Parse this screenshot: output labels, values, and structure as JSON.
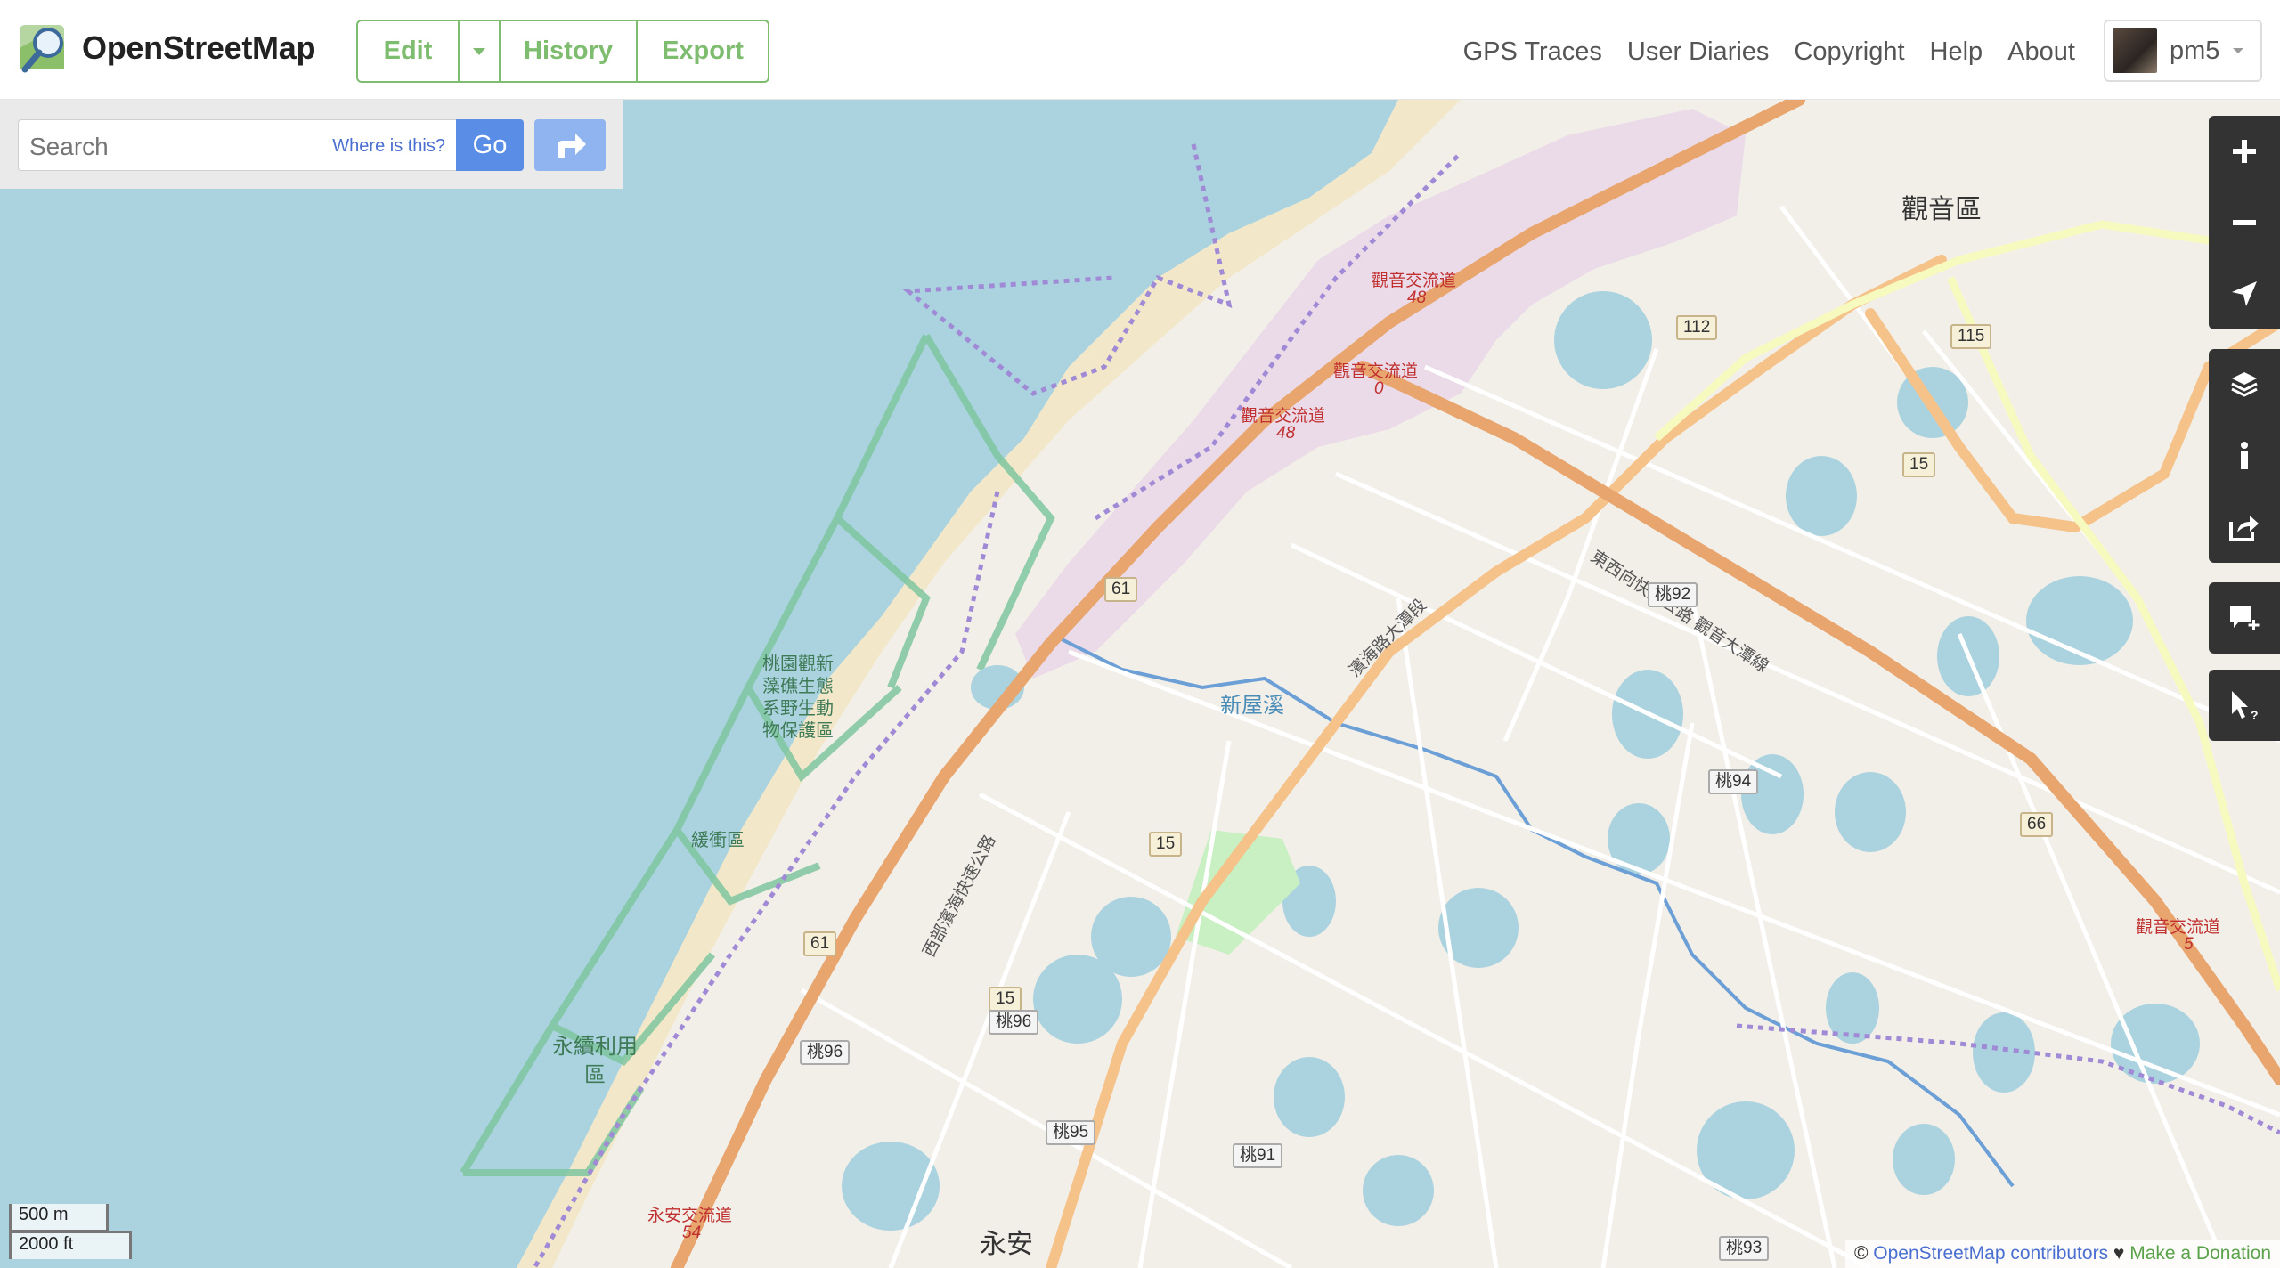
{
  "header": {
    "app_title": "OpenStreetMap",
    "edit_label": "Edit",
    "history_label": "History",
    "export_label": "Export",
    "nav": [
      "GPS Traces",
      "User Diaries",
      "Copyright",
      "Help",
      "About"
    ],
    "user": {
      "name": "pm5"
    }
  },
  "search": {
    "placeholder": "Search",
    "where_label": "Where is this?",
    "go_label": "Go"
  },
  "controls": {
    "zoom_in": "+",
    "zoom_out": "−",
    "icons": [
      "zoom-in-icon",
      "zoom-out-icon",
      "locate-icon",
      "layers-icon",
      "info-icon",
      "share-icon",
      "add-note-icon",
      "query-features-icon"
    ]
  },
  "map": {
    "labels": {
      "district_guanyin": "觀音區",
      "district_yongan": "永安",
      "interchange_48_a": "觀音交流道",
      "interchange_48_a_num": "48",
      "interchange_0": "觀音交流道",
      "interchange_0_num": "0",
      "interchange_48_b": "觀音交流道",
      "interchange_48_b_num": "48",
      "interchange_5": "觀音交流道",
      "interchange_5_num": "5",
      "interchange_yongan": "永安交流道",
      "interchange_yongan_num": "54",
      "reserve_line1": "桃園觀新",
      "reserve_line2": "藻礁生態",
      "reserve_line3": "系野生動",
      "reserve_line4": "物保護區",
      "buffer_zone": "緩衝區",
      "sustainable_zone_1": "永續利用",
      "sustainable_zone_2": "區",
      "creek": "新屋溪",
      "road_east_west_expressway": "東西向快速公路 觀音大潭線",
      "road_west_coast_expressway": "西部濱海快速公路",
      "road_coastal": "濱海路大潭段"
    },
    "shields": {
      "r112": "112",
      "r115": "115",
      "r15a": "15",
      "r15b": "15",
      "r15c": "15",
      "r61a": "61",
      "r61b": "61",
      "r66": "66",
      "t92": "桃92",
      "t94": "桃94",
      "t96a": "桃96",
      "t96b": "桃96",
      "t95": "桃95",
      "t91": "桃91",
      "t93": "桃93"
    }
  },
  "scale": {
    "metric": "500 m",
    "imperial": "2000 ft"
  },
  "attribution": {
    "copyright_symbol": "©",
    "contributors": "OpenStreetMap contributors",
    "heart": "♥",
    "donate": "Make a Donation"
  }
}
